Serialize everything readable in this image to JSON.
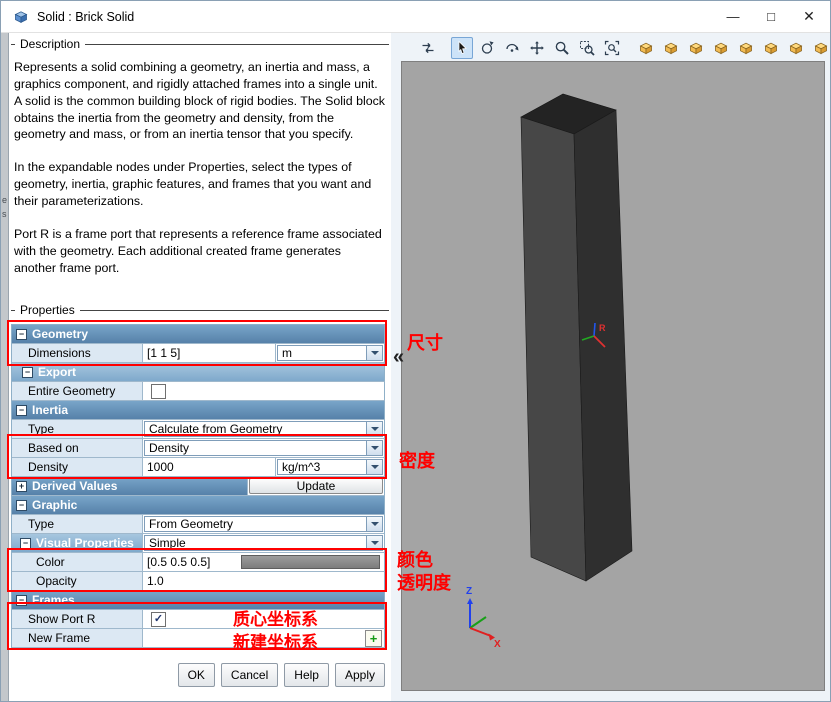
{
  "window": {
    "title": "Solid : Brick Solid",
    "controls": {
      "minimize": "—",
      "maximize": "□",
      "close": "✕"
    }
  },
  "outside": {
    "fragment_e": "e",
    "fragment_s": "s"
  },
  "icons": {
    "open": "−",
    "closed": "+",
    "check": "✓",
    "add": "+",
    "collapse": "«"
  },
  "description": {
    "heading": "Description",
    "paragraphs": {
      "p1": "Represents a solid combining a geometry, an inertia and mass, a graphics component, and rigidly attached frames into a single unit. A solid is the common building block of rigid bodies. The Solid block obtains the inertia from the geometry and density, from the geometry and mass, or from an inertia tensor that you specify.",
      "p2": "In the expandable nodes under Properties, select the types of geometry, inertia, graphic features, and frames that you want and their parameterizations.",
      "p3": "Port R is a frame port that represents a reference frame associated with the geometry. Each additional created frame generates another frame port."
    }
  },
  "properties": {
    "heading": "Properties",
    "rows": [
      {
        "label": "Geometry"
      },
      {
        "label": "Dimensions",
        "value": "[1 1 5]",
        "unit": "m"
      },
      {
        "label": "Export"
      },
      {
        "label": "Entire Geometry"
      },
      {
        "label": "Inertia"
      },
      {
        "label": "Type",
        "value": "Calculate from Geometry"
      },
      {
        "label": "Based on",
        "value": "Density"
      },
      {
        "label": "Density",
        "value": "1000",
        "unit": "kg/m^3"
      },
      {
        "label": "Derived Values",
        "button": "Update"
      },
      {
        "label": "Graphic"
      },
      {
        "label": "Type",
        "value": "From Geometry"
      },
      {
        "label": "Visual Properties",
        "value": "Simple"
      },
      {
        "label": "Color",
        "value": "[0.5 0.5 0.5]",
        "swatch": "#8c8c8c"
      },
      {
        "label": "Opacity",
        "value": "1.0"
      },
      {
        "label": "Frames"
      },
      {
        "label": "Show Port R"
      },
      {
        "label": "New Frame"
      }
    ]
  },
  "actions": {
    "ok": "OK",
    "cancel": "Cancel",
    "help": "Help",
    "apply": "Apply"
  },
  "annotations": {
    "dimensions": "尺寸",
    "density": "密度",
    "color": "颜色",
    "opacity": "透明度",
    "com_frame": "质心坐标系",
    "new_frame": "新建坐标系"
  },
  "toolbar": {
    "icons": [
      "swap-panes",
      "select",
      "orbit",
      "roll",
      "pan",
      "zoom",
      "zoom-region",
      "fit-view",
      "view-isometric",
      "view-front",
      "view-back",
      "view-top",
      "view-bottom",
      "view-left",
      "view-right",
      "view-perspective",
      "show-frames"
    ]
  },
  "viewport": {
    "port_frame_label": "R",
    "world_axis_z": "Z",
    "world_axis_x": "X"
  }
}
